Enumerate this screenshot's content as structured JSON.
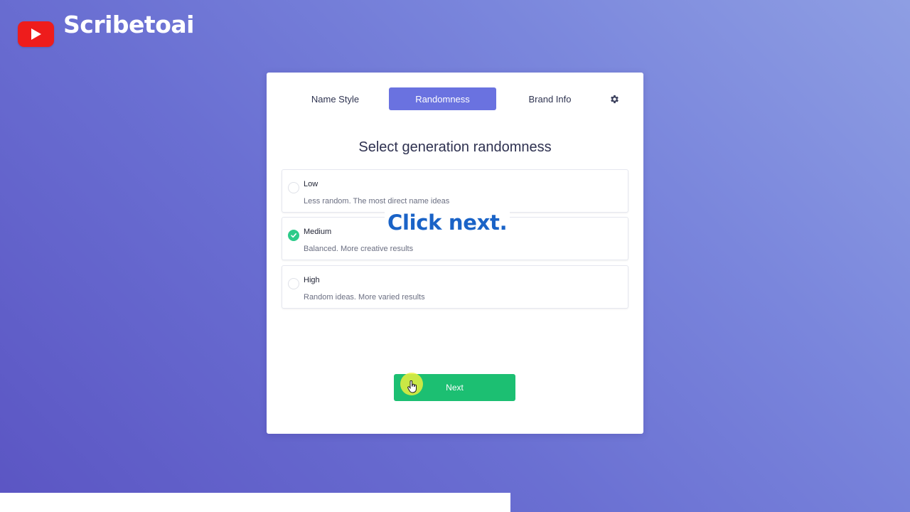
{
  "brand": {
    "name": "Scribetoai"
  },
  "tabs": [
    {
      "label": "Name Style",
      "active": false
    },
    {
      "label": "Randomness",
      "active": true
    },
    {
      "label": "Brand Info",
      "active": false
    }
  ],
  "settings_icon": "gear-icon",
  "heading": "Select generation randomness",
  "options": [
    {
      "label": "Low",
      "description": "Less random. The most direct name ideas",
      "selected": false
    },
    {
      "label": "Medium",
      "description": "Balanced. More creative results",
      "selected": true
    },
    {
      "label": "High",
      "description": "Random ideas. More varied results",
      "selected": false
    }
  ],
  "next_button": {
    "label": "Next"
  },
  "caption": "Click next.",
  "colors": {
    "accent": "#6a72e0",
    "success": "#1cbf72",
    "check": "#2dcb8a",
    "caption_text": "#1a63c7"
  }
}
